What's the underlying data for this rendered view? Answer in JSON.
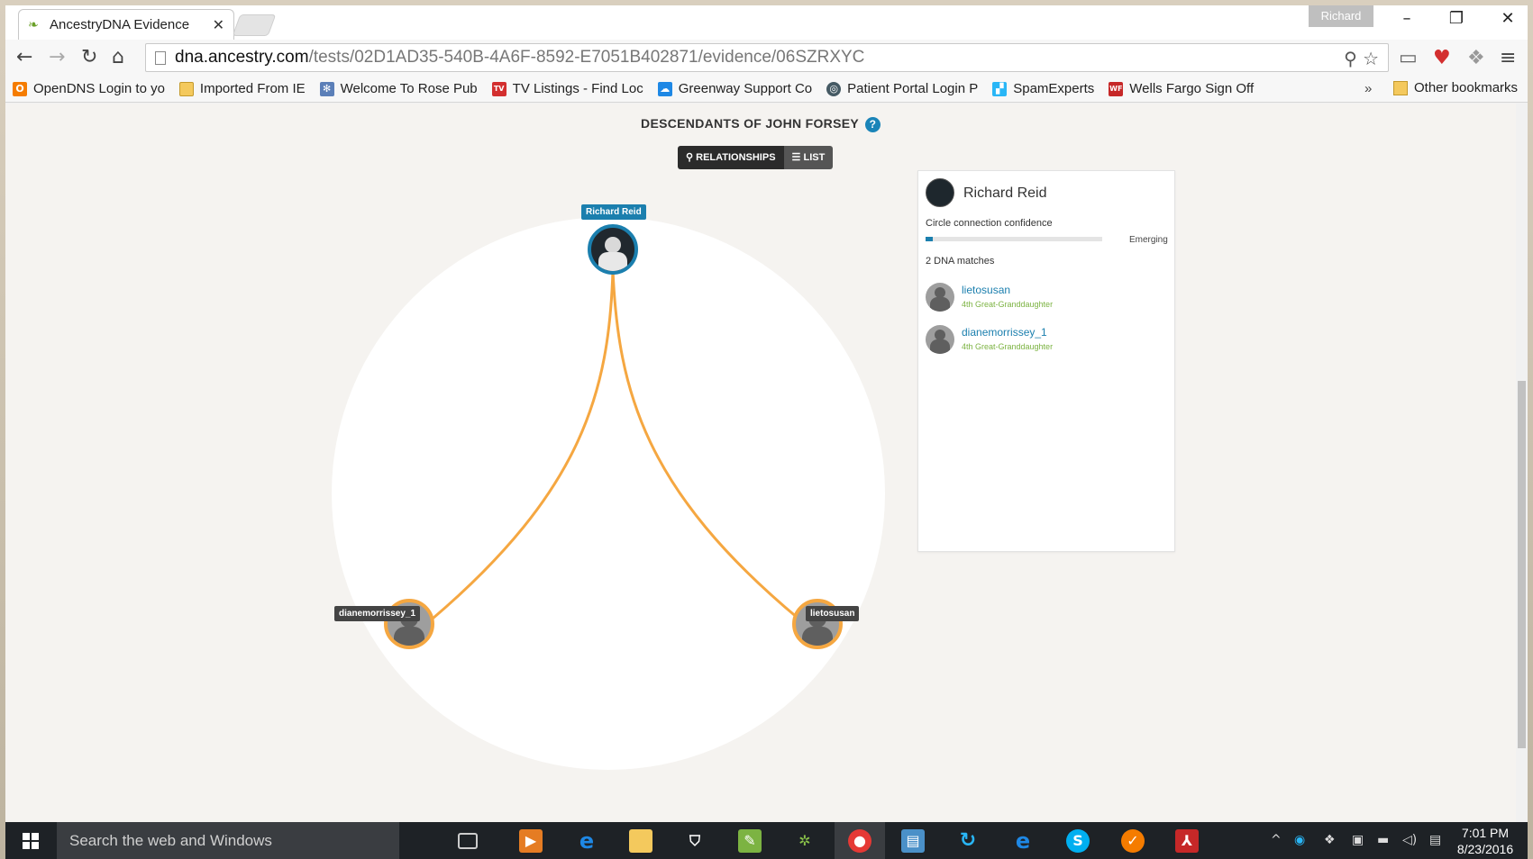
{
  "browser": {
    "tab_title": "AncestryDNA Evidence",
    "profile_name": "Richard",
    "url_host": "dna.ancestry.com",
    "url_path": "/tests/02D1AD35-540B-4A6F-8592-E7051B402871/evidence/06SZRXYC"
  },
  "bookmarks": [
    {
      "label": "OpenDNS Login to yo",
      "icon": "opendns-icon",
      "color": "#f57c00",
      "glyph": "O"
    },
    {
      "label": "Imported From IE",
      "icon": "folder-icon",
      "color": "#f4c95d",
      "glyph": ""
    },
    {
      "label": "Welcome To Rose Pub",
      "icon": "gear-icon",
      "color": "#5b7fb8",
      "glyph": "✻"
    },
    {
      "label": "TV Listings - Find Loc",
      "icon": "tv-guide-icon",
      "color": "#d32f2f",
      "glyph": "TV"
    },
    {
      "label": "Greenway Support Co",
      "icon": "cloud-icon",
      "color": "#1e88e5",
      "glyph": "☁"
    },
    {
      "label": "Patient Portal Login P",
      "icon": "portal-icon",
      "color": "#455a64",
      "glyph": "◎"
    },
    {
      "label": "SpamExperts",
      "icon": "spamexperts-icon",
      "color": "#29b6f6",
      "glyph": "▞"
    },
    {
      "label": "Wells Fargo Sign Off",
      "icon": "wellsfargo-icon",
      "color": "#c62828",
      "glyph": "WF"
    }
  ],
  "bookmarks_more": "»",
  "bookmarks_other": "Other bookmarks",
  "page": {
    "title": "DESCENDANTS OF JOHN FORSEY",
    "help_glyph": "?",
    "view_relationships": "RELATIONSHIPS",
    "view_list": "LIST"
  },
  "graph": {
    "center": {
      "name": "Richard Reid"
    },
    "matches": [
      {
        "name": "dianemorrissey_1"
      },
      {
        "name": "lietosusan"
      }
    ],
    "link_color": "#f5a741",
    "center_color": "#1b7fae"
  },
  "panel": {
    "name": "Richard Reid",
    "confidence_label": "Circle connection confidence",
    "confidence_level": "Emerging",
    "confidence_value": 0.04,
    "match_count": "2 DNA matches",
    "matches": [
      {
        "name": "lietosusan",
        "relationship": "4th Great-Granddaughter"
      },
      {
        "name": "dianemorrissey_1",
        "relationship": "4th Great-Granddaughter"
      }
    ]
  },
  "taskbar": {
    "search_placeholder": "Search the web and Windows",
    "time": "7:01 PM",
    "date": "8/23/2016"
  }
}
